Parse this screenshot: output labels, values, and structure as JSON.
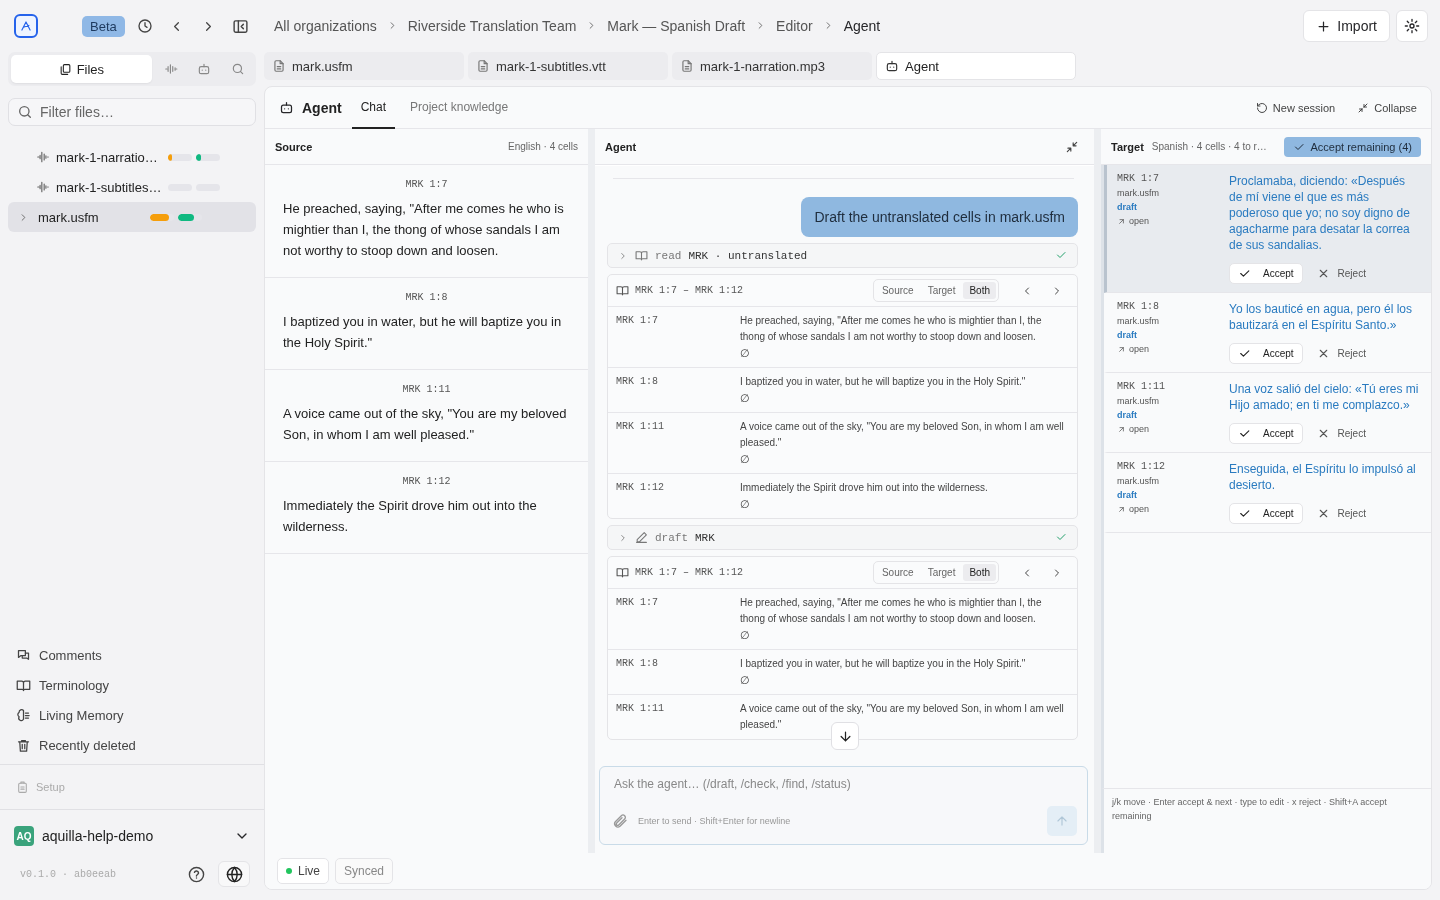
{
  "topbar": {
    "badge": "Beta",
    "breadcrumbs": [
      "All organizations",
      "Riverside Translation Team",
      "Mark — Spanish Draft",
      "Editor",
      "Agent"
    ],
    "import_button": "Import"
  },
  "sidebar": {
    "tabs": [
      {
        "kind": "files",
        "label": "Files",
        "selected": true
      },
      {
        "kind": "waveform",
        "selected": false
      },
      {
        "kind": "robot",
        "selected": false
      },
      {
        "kind": "search",
        "selected": false
      }
    ],
    "filter": {
      "placeholder": "Filter files…"
    },
    "files": [
      {
        "kind": "audio",
        "name": "mark-1-narratio…",
        "selected": false,
        "progress": [
          {
            "color": "#f59e0b",
            "level": 0.15
          },
          {
            "color": "#10b981",
            "level": 0.2
          }
        ]
      },
      {
        "kind": "audio",
        "name": "mark-1-subtitles…",
        "selected": false
      },
      {
        "kind": "document",
        "name": "mark.usfm",
        "selected": true,
        "progress": [
          {
            "color": "#f59e0b",
            "level": 0.8
          },
          {
            "color": "#10b981",
            "level": 0.65
          }
        ]
      }
    ],
    "nav": [
      {
        "kind": "comments",
        "label": "Comments"
      },
      {
        "kind": "book",
        "label": "Terminology"
      },
      {
        "kind": "brain",
        "label": "Living Memory"
      },
      {
        "kind": "trash",
        "label": "Recently deleted"
      }
    ],
    "setup": {
      "label": "Setup",
      "disabled": true
    },
    "org": {
      "initials": "AQ",
      "name": "aquilla-help-demo"
    },
    "version": "v0.1.0 · ab0eeab"
  },
  "file_tabs": [
    {
      "kind": "document",
      "label": "mark.usfm",
      "selected": false
    },
    {
      "kind": "document",
      "label": "mark-1-subtitles.vtt",
      "selected": false
    },
    {
      "kind": "document",
      "label": "mark-1-narration.mp3",
      "selected": false
    },
    {
      "kind": "robot",
      "label": "Agent",
      "selected": true
    }
  ],
  "panel": {
    "title": "Agent",
    "tabs": [
      {
        "label": "Chat",
        "selected": true
      },
      {
        "label": "Project knowledge",
        "selected": false
      }
    ],
    "actions": [
      {
        "kind": "refresh",
        "label": "New session"
      },
      {
        "kind": "collapse",
        "label": "Collapse"
      }
    ]
  },
  "source": {
    "title": "Source",
    "meta": "English · 4 cells",
    "cells": [
      {
        "ref": "MRK 1:7",
        "text": "He preached, saying, \"After me comes he who is mightier than I, the thong of whose sandals I am not worthy to stoop down and loosen."
      },
      {
        "ref": "MRK 1:8",
        "text": "I baptized you in water, but he will baptize you in the Holy Spirit.\""
      },
      {
        "ref": "MRK 1:11",
        "text": "A voice came out of the sky, \"You are my beloved Son, in whom I am well pleased.\""
      },
      {
        "ref": "MRK 1:12",
        "text": "Immediately the Spirit drove him out into the wilderness."
      }
    ]
  },
  "agent": {
    "title": "Agent",
    "messages": [
      {
        "kind": "user",
        "text": "Draft the untranslated cells in mark.usfm"
      },
      {
        "kind": "read_tool",
        "name": "read",
        "args": "MRK · untranslated",
        "done": true
      },
      {
        "kind": "passages",
        "range": "MRK 1:7 – MRK 1:12",
        "views": [
          {
            "label": "Source",
            "selected": false
          },
          {
            "label": "Target",
            "selected": false
          },
          {
            "label": "Both",
            "selected": true
          }
        ],
        "rows": [
          {
            "ref": "MRK 1:7",
            "text": "He preached, saying, \"After me comes he who is mightier than I, the thong of whose sandals I am not worthy to stoop down and loosen.",
            "target": "∅"
          },
          {
            "ref": "MRK 1:8",
            "text": "I baptized you in water, but he will baptize you in the Holy Spirit.\"",
            "target": "∅"
          },
          {
            "ref": "MRK 1:11",
            "text": "A voice came out of the sky, \"You are my beloved Son, in whom I am well pleased.\"",
            "target": "∅"
          },
          {
            "ref": "MRK 1:12",
            "text": "Immediately the Spirit drove him out into the wilderness.",
            "target": "∅"
          }
        ]
      },
      {
        "kind": "draft_tool",
        "name": "draft",
        "args": "MRK",
        "done": true
      },
      {
        "kind": "passages",
        "range": "MRK 1:7 – MRK 1:12",
        "views": [
          {
            "label": "Source",
            "selected": false
          },
          {
            "label": "Target",
            "selected": false
          },
          {
            "label": "Both",
            "selected": true
          }
        ],
        "rows": [
          {
            "ref": "MRK 1:7",
            "text": "He preached, saying, \"After me comes he who is mightier than I, the thong of whose sandals I am not worthy to stoop down and loosen.",
            "target": "∅"
          },
          {
            "ref": "MRK 1:8",
            "text": "I baptized you in water, but he will baptize you in the Holy Spirit.\"",
            "target": "∅"
          },
          {
            "ref": "MRK 1:11",
            "text": "A voice came out of the sky, \"You are my beloved Son, in whom I am well pleased.\""
          }
        ]
      }
    ],
    "composer": {
      "placeholder": "Ask the agent… (/draft, /check, /find, /status)",
      "hint": "Enter to send · Shift+Enter for newline"
    }
  },
  "target": {
    "title": "Target",
    "meta": "Spanish · 4 cells · 4 to r…",
    "accept_all": "Accept remaining (4)",
    "cells": [
      {
        "ref": "MRK 1:7",
        "file": "mark.usfm",
        "status": "draft",
        "open": "open",
        "text": "Proclamaba, diciendo: «Después de mí viene el que es más poderoso que yo; no soy digno de agacharme para desatar la correa de sus sandalias.",
        "accept": "Accept",
        "reject": "Reject",
        "selected": true
      },
      {
        "ref": "MRK 1:8",
        "file": "mark.usfm",
        "status": "draft",
        "open": "open",
        "text": "Yo los bauticé en agua, pero él los bautizará en el Espíritu Santo.»",
        "accept": "Accept",
        "reject": "Reject",
        "selected": false
      },
      {
        "ref": "MRK 1:11",
        "file": "mark.usfm",
        "status": "draft",
        "open": "open",
        "text": "Una voz salió del cielo: «Tú eres mi Hijo amado; en ti me complazco.»",
        "accept": "Accept",
        "reject": "Reject",
        "selected": false
      },
      {
        "ref": "MRK 1:12",
        "file": "mark.usfm",
        "status": "draft",
        "open": "open",
        "text": "Enseguida, el Espíritu lo impulsó al desierto.",
        "accept": "Accept",
        "reject": "Reject",
        "selected": false
      }
    ],
    "hint": "j/k move · Enter accept & next · type to edit · x reject · Shift+A accept remaining"
  },
  "status": [
    {
      "kind": "live",
      "label": "Live"
    },
    {
      "kind": "plain",
      "label": "Synced"
    }
  ]
}
